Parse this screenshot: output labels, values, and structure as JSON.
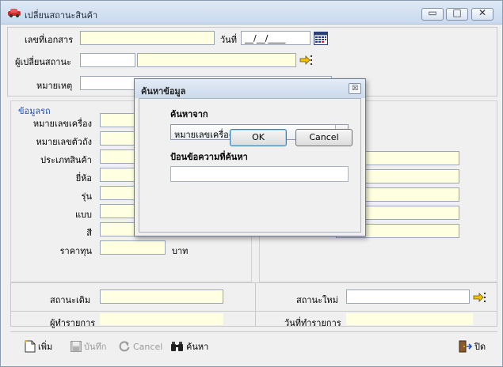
{
  "window": {
    "title": "เปลี่ยนสถานะสินค้า",
    "icon": "car-icon",
    "controls": {
      "minimize": "▭",
      "maximize": "□",
      "close": "✕"
    }
  },
  "header": {
    "doc_no_label": "เลขที่เอกสาร",
    "doc_no_value": "",
    "date_label": "วันที่",
    "date_value": "__/__/____",
    "changer_label": "ผู้เปลี่ยนสถานะ",
    "changer_code": "",
    "changer_name": "",
    "note_label": "หมายเหตุ",
    "note_value": ""
  },
  "vehicle": {
    "group_title": "ข้อมูลรถ",
    "fields": [
      {
        "label": "หมายเลขเครื่อง"
      },
      {
        "label": "หมายเลขตัวถัง"
      },
      {
        "label": "ประเภทสินค้า"
      },
      {
        "label": "ยี่ห้อ"
      },
      {
        "label": "รุ่น"
      },
      {
        "label": "แบบ"
      },
      {
        "label": "สี"
      },
      {
        "label": "ราคาทุน"
      }
    ],
    "cost_unit": "บาท"
  },
  "status": {
    "old_label": "สถานะเดิม",
    "old_value": "",
    "new_label": "สถานะใหม่",
    "new_value": "",
    "maker_label": "ผู้ทำรายการ",
    "date_label": "วันที่ทำรายการ"
  },
  "toolbar": {
    "add": "เพิ่ม",
    "save": "บันทึก",
    "cancel": "Cancel",
    "search": "ค้นหา",
    "close": "ปิด"
  },
  "dialog": {
    "title": "ค้นหาข้อมูล",
    "search_from_label": "ค้นหาจาก",
    "search_from_value": "หมายเลขเครื่อง",
    "keyword_label": "ป้อนข้อความที่ค้นหา",
    "keyword_value": "",
    "ok": "OK",
    "cancel": "Cancel",
    "close": "☒"
  },
  "colors": {
    "field_yellow": "#ffffe1",
    "group_title": "#1f4fbf",
    "window_bg": "#f0f0f0"
  }
}
